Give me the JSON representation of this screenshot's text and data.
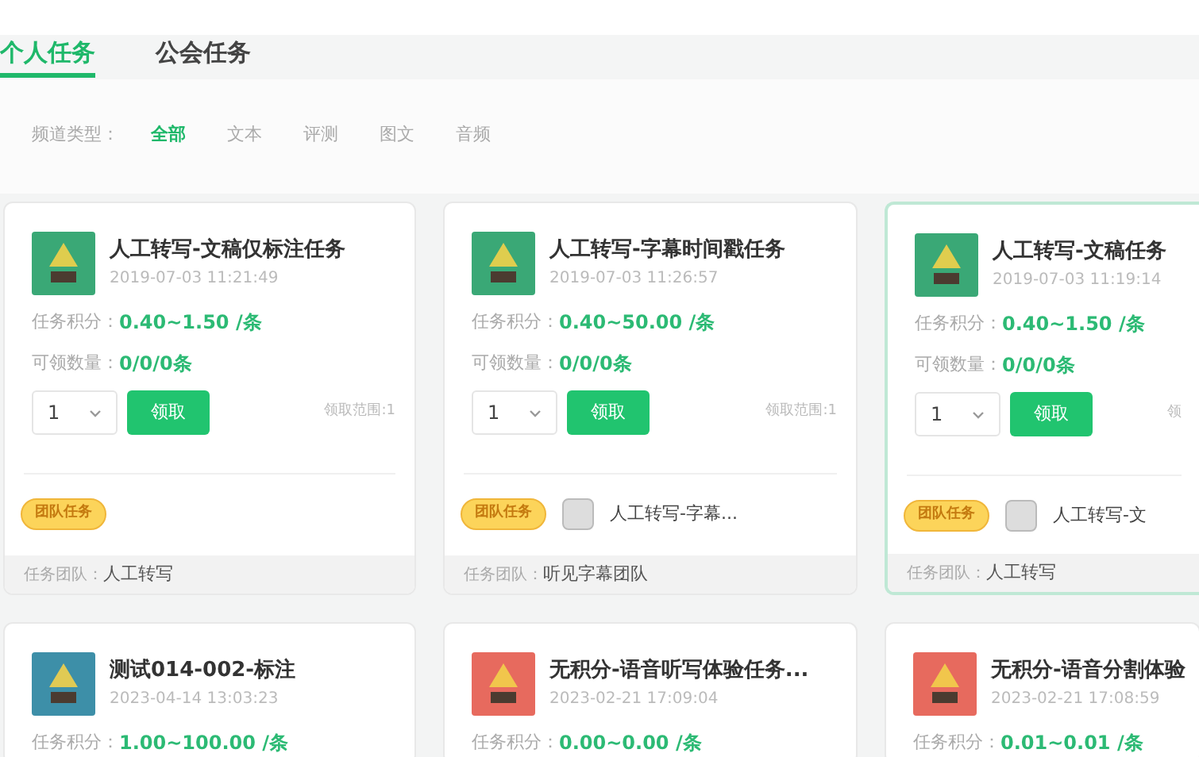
{
  "tabs": [
    {
      "label": "个人任务",
      "selected": true
    },
    {
      "label": "公会任务",
      "selected": false
    }
  ],
  "filter": {
    "label": "频道类型：",
    "options": [
      {
        "label": "全部",
        "selected": true
      },
      {
        "label": "文本",
        "selected": false
      },
      {
        "label": "评测",
        "selected": false
      },
      {
        "label": "图文",
        "selected": false
      },
      {
        "label": "音频",
        "selected": false
      }
    ]
  },
  "tasks": [
    {
      "title": "人工转写-文稿仅标注任务",
      "time": "2019-07-03 11:21:49",
      "color": "#3aa876",
      "points_label": "任务积分：",
      "points": "0.40~1.50 /条",
      "quantity_label": "可领数量：",
      "quantity": "0/0/0条",
      "select_value": "1",
      "claim_button": "领取",
      "range": "领取范围:1",
      "badge": "团队任务",
      "team_label": "任务团队：",
      "team": "人工转写",
      "selected": false
    },
    {
      "title": "人工转写-字幕时间戳任务",
      "time": "2019-07-03 11:26:57",
      "color": "#3aa876",
      "points_label": "任务积分：",
      "points": "0.40~50.00 /条",
      "quantity_label": "可领数量：",
      "quantity": "0/0/0条",
      "select_value": "1",
      "claim_button": "领取",
      "range": "领取范围:1",
      "badge": "团队任务",
      "team_project": "人工转写-字幕...",
      "team_label": "任务团队：",
      "team": "听见字幕团队",
      "selected": false
    },
    {
      "title": "人工转写-文稿任务",
      "time": "2019-07-03 11:19:14",
      "color": "#3aa876",
      "points_label": "任务积分：",
      "points": "0.40~1.50 /条",
      "quantity_label": "可领数量：",
      "quantity": "0/0/0条",
      "select_value": "1",
      "claim_button": "领取",
      "range": "领",
      "badge": "团队任务",
      "team_project": "人工转写-文",
      "team_label": "任务团队：",
      "team": "人工转写",
      "selected": true
    },
    {
      "title": "测试014-002-标注",
      "time": "2023-04-14 13:03:23",
      "color": "#3d8fa8",
      "points_label": "任务积分：",
      "points": "1.00~100.00 /条",
      "selected": false
    },
    {
      "title": "无积分-语音听写体验任务...",
      "time": "2023-02-21 17:09:04",
      "color": "#e76a5e",
      "points_label": "任务积分：",
      "points": "0.00~0.00 /条",
      "selected": false
    },
    {
      "title": "无积分-语音分割体验",
      "time": "2023-02-21 17:08:59",
      "color": "#e76a5e",
      "points_label": "任务积分：",
      "points": "0.01~0.01 /条",
      "selected": false
    }
  ]
}
